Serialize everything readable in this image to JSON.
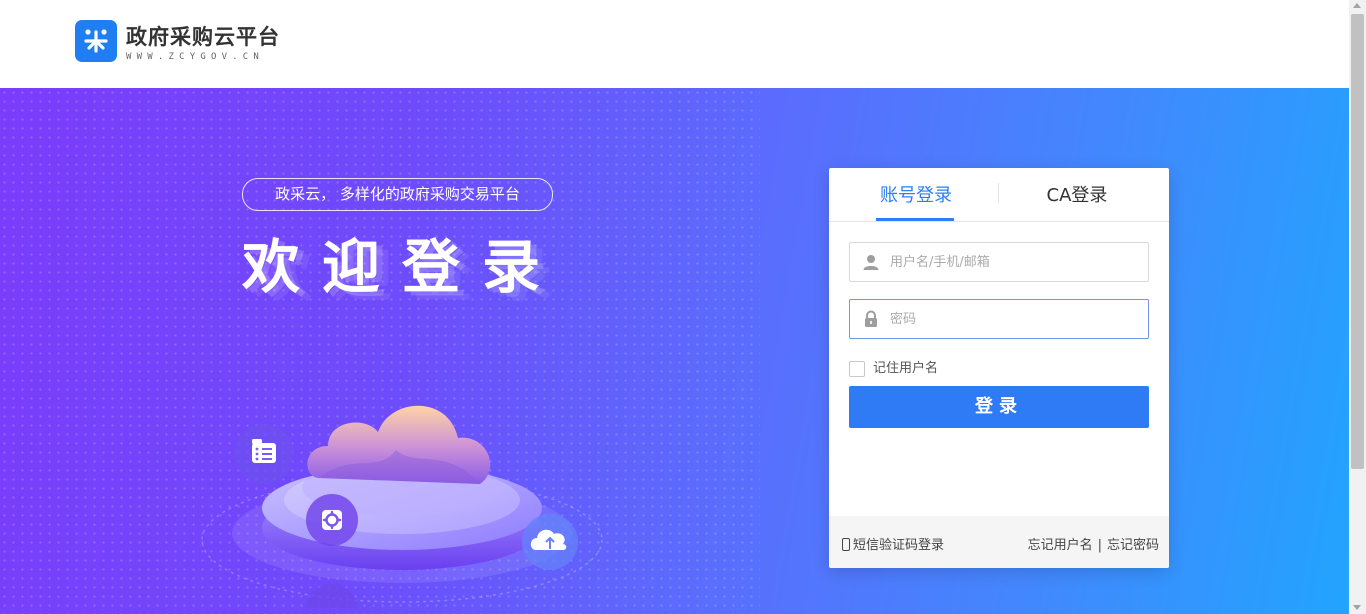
{
  "header": {
    "logo_title": "政府采购云平台",
    "logo_subtitle": "WWW.ZCYGOV.CN"
  },
  "banner": {
    "slogan": "政采云，  多样化的政府采购交易平台",
    "welcome": "欢迎登录"
  },
  "login": {
    "tabs": [
      {
        "label": "账号登录",
        "active": true
      },
      {
        "label": "CA登录",
        "active": false
      }
    ],
    "username_placeholder": "用户名/手机/邮箱",
    "password_placeholder": "密码",
    "remember_label": "记住用户名",
    "remember_checked": false,
    "submit_label": "登录",
    "sms_login_label": "短信验证码登录",
    "forgot_username_label": "忘记用户名",
    "separator": "|",
    "forgot_password_label": "忘记密码"
  },
  "icons": {
    "logo": "zcy-logo-icon",
    "username": "user-icon",
    "password": "lock-icon",
    "sms": "phone-icon",
    "illustration": [
      "list-icon",
      "cloud-upload-icon",
      "gear-icon"
    ]
  },
  "colors": {
    "primary": "#2f7bf6",
    "banner_start": "#7b3cfb",
    "banner_end": "#22a4fe"
  }
}
